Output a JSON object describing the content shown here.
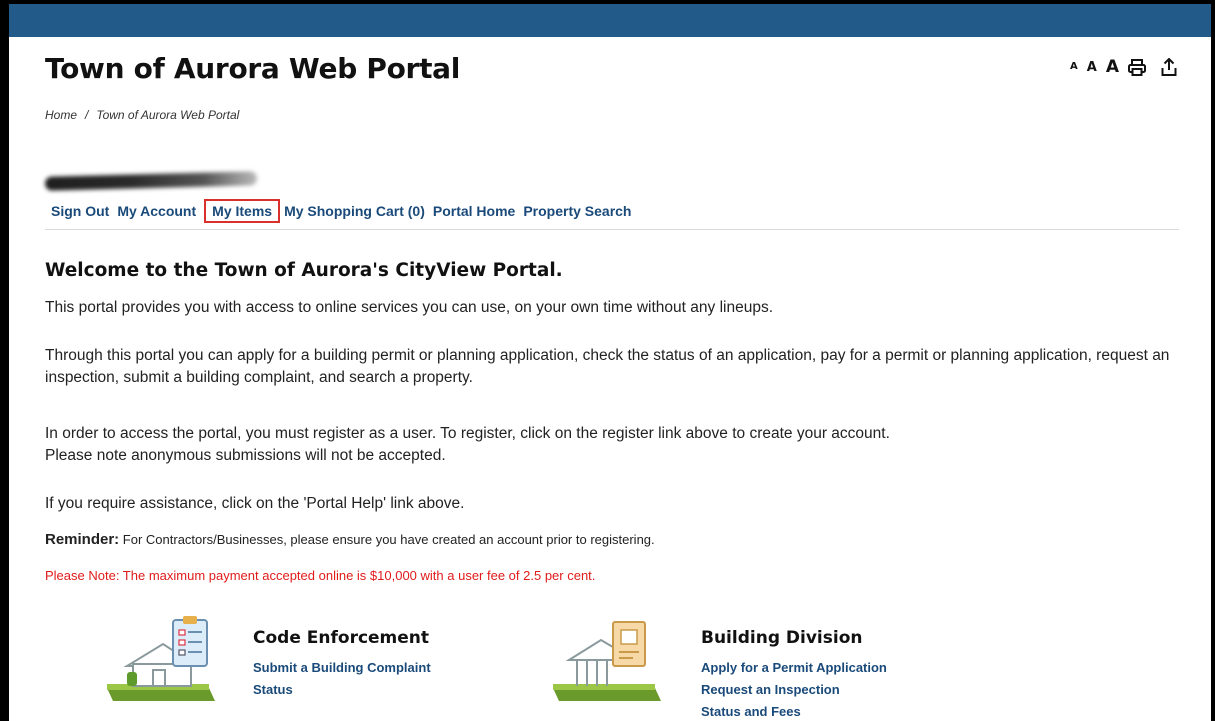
{
  "page": {
    "title": "Town of Aurora Web Portal",
    "breadcrumb": {
      "home": "Home",
      "separator": "/",
      "current": "Town of Aurora Web Portal"
    }
  },
  "toolbar": {
    "font_small": "A",
    "font_medium": "A",
    "font_large": "A",
    "icons": [
      "print-icon",
      "share-icon"
    ]
  },
  "nav": {
    "items": [
      {
        "label": "Sign Out"
      },
      {
        "label": "My Account"
      },
      {
        "label": "My Items"
      },
      {
        "label": "My Shopping Cart (0)"
      },
      {
        "label": "Portal Home"
      },
      {
        "label": "Property Search"
      }
    ]
  },
  "content": {
    "heading": "Welcome to the Town of Aurora's CityView Portal.",
    "p1": "This portal provides you with access to online services you can use, on your own time without any lineups.",
    "p2": "Through this portal you can apply for a building permit or planning application, check the status of an application, pay for a permit or planning application, request an inspection, submit a building complaint, and search a property.",
    "p3_line1": "In order to access the portal, you must register as a user. To register, click on the register link above to create your account.",
    "p3_line2": "Please note anonymous submissions will not be accepted.",
    "p4": "If you require assistance, click on the 'Portal Help' link above.",
    "reminder_label": "Reminder:",
    "reminder_text": " For Contractors/Businesses, please ensure you have created an account prior to registering.",
    "note": "Please Note: The maximum payment accepted online is $10,000 with a user fee of 2.5 per cent."
  },
  "services": [
    {
      "title": "Code Enforcement",
      "links": [
        "Submit a Building Complaint",
        "Status"
      ]
    },
    {
      "title": "Building Division",
      "links": [
        "Apply for a Permit Application",
        "Request an Inspection",
        "Status and Fees"
      ]
    }
  ],
  "colors": {
    "header_bar": "#225a8a",
    "link": "#1a4a7a",
    "warning": "#e11b1b",
    "highlight_box": "#d9302c"
  }
}
